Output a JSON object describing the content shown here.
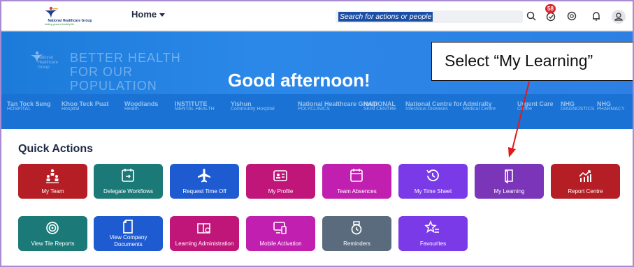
{
  "header": {
    "logo_text": "National Healthcare Group",
    "logo_tagline": "Adding years of healthy life",
    "home_menu_label": "Home",
    "search_placeholder": "Search for actions or people",
    "notification_count": "58",
    "icons": [
      "search-icon",
      "tasks-icon",
      "support-icon",
      "bell-icon",
      "user-icon"
    ]
  },
  "banner": {
    "tagline": "BETTER HEALTH FOR OUR POPULATION",
    "logo_text": "National Healthcare Group",
    "greeting": "Good afternoon!"
  },
  "clusters": [
    {
      "name": "Tan Tock Seng",
      "sub": "HOSPITAL"
    },
    {
      "name": "Khoo Teck Puat",
      "sub": "Hospital"
    },
    {
      "name": "Woodlands",
      "sub": "Health"
    },
    {
      "name": "INSTITUTE",
      "sub": "MENTAL HEALTH"
    },
    {
      "name": "Yishun",
      "sub": "Community Hospital"
    },
    {
      "name": "National Healthcare Group",
      "sub": "POLYCLINICS"
    },
    {
      "name": "NATIONAL",
      "sub": "SKIN CENTRE"
    },
    {
      "name": "National Centre for",
      "sub": "Infectious Diseases"
    },
    {
      "name": "Admiralty",
      "sub": "Medical Centre"
    },
    {
      "name": "Urgent Care",
      "sub": "Centre"
    },
    {
      "name": "NHG",
      "sub": "DIAGNOSTICS"
    },
    {
      "name": "NHG",
      "sub": "PHARMACY"
    }
  ],
  "callout": {
    "text": "Select “My Learning”"
  },
  "quick_actions": {
    "title": "Quick Actions",
    "tiles": [
      {
        "label": "My Team",
        "icon": "team-icon",
        "color": "#b41e24"
      },
      {
        "label": "Delegate Workflows",
        "icon": "delegate-calendar-icon",
        "color": "#1b7a78"
      },
      {
        "label": "Request Time Off",
        "icon": "airplane-icon",
        "color": "#1e5bd0"
      },
      {
        "label": "My Profile",
        "icon": "profile-card-icon",
        "color": "#c0167a"
      },
      {
        "label": "Team Absences",
        "icon": "calendar-icon",
        "color": "#c11fb0"
      },
      {
        "label": "My Time Sheet",
        "icon": "history-icon",
        "color": "#7a3ae8"
      },
      {
        "label": "My Learning",
        "icon": "book-icon",
        "color": "#7a35b9"
      },
      {
        "label": "Report Centre",
        "icon": "chart-icon",
        "color": "#b41e24"
      },
      {
        "label": "View Tile Reports",
        "icon": "target-icon",
        "color": "#1b7a78"
      },
      {
        "label": "View Company Documents",
        "icon": "document-icon",
        "color": "#1e5bd0"
      },
      {
        "label": "Learning Administration",
        "icon": "book-admin-icon",
        "color": "#c0167a"
      },
      {
        "label": "Mobile Activation",
        "icon": "device-icon",
        "color": "#c11fb0"
      },
      {
        "label": "Reminders",
        "icon": "reminder-icon",
        "color": "#5a6b7e"
      },
      {
        "label": "Favourites",
        "icon": "star-list-icon",
        "color": "#7a3ae8"
      }
    ]
  }
}
